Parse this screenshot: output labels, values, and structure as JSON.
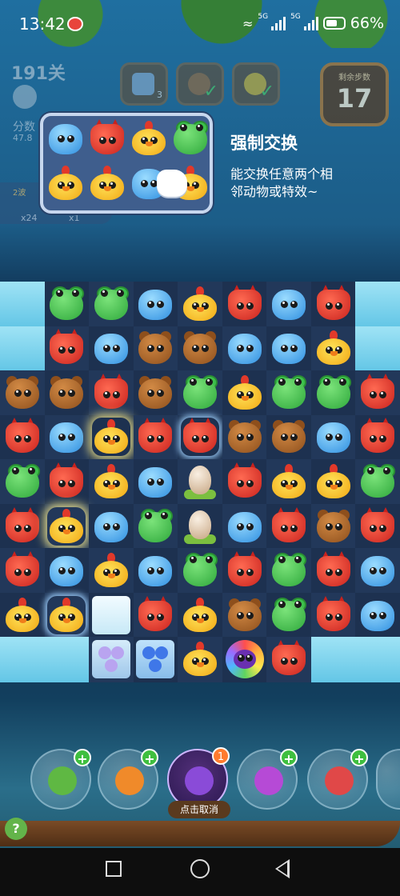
{
  "status_bar": {
    "time": "13:42",
    "network_1": "5G",
    "network_2": "5G",
    "battery": "66%",
    "battery_level": 0.66,
    "icons": [
      "weibo-icon",
      "wifi-icon",
      "signal-icon",
      "battery-icon"
    ]
  },
  "hud": {
    "level": "191关",
    "score_label": "分数",
    "score_value": "47.8",
    "steps_label": "剩余步数",
    "steps_value": "17",
    "goal_1_count": "3",
    "side_badge": "2波",
    "counter_1": "x24",
    "counter_2": "x1"
  },
  "tooltip": {
    "title": "强制交换",
    "line1": "能交换任意两个相",
    "line2": "邻动物或特效~",
    "preview_rows": [
      [
        "blue",
        "fox",
        "chick",
        "frog"
      ],
      [
        "chick",
        "chick",
        "blue",
        "chick"
      ]
    ]
  },
  "board": {
    "rows": [
      [
        "ice",
        "frog",
        "frog",
        "blue",
        "chick",
        "fox",
        "blue",
        "fox",
        "ice"
      ],
      [
        "ice",
        "fox",
        "blue",
        "bear",
        "bear",
        "blue",
        "blue",
        "chick",
        "ice"
      ],
      [
        "bear",
        "bear",
        "fox",
        "bear",
        "frog",
        "chick",
        "frog",
        "frog",
        "fox"
      ],
      [
        "fox",
        "blue",
        "chick*",
        "fox",
        "fox~",
        "bear",
        "bear",
        "blue",
        "fox"
      ],
      [
        "frog",
        "fox",
        "chick",
        "blue",
        "egg",
        "fox",
        "chick",
        "chick",
        "frog"
      ],
      [
        "fox",
        "chick*",
        "blue",
        "frog",
        "egg",
        "blue",
        "fox",
        "bear",
        "fox"
      ],
      [
        "fox",
        "blue",
        "chick",
        "blue",
        "frog",
        "fox",
        "frog",
        "fox",
        "blue"
      ],
      [
        "chick",
        "chick~",
        "iceblock",
        "fox",
        "chick",
        "bear",
        "frog",
        "fox",
        "blue"
      ],
      [
        "ice",
        "ice",
        "purple-ice",
        "blue-ice",
        "chick",
        "owl",
        "fox",
        "ice",
        "ice"
      ]
    ]
  },
  "boosters": [
    {
      "name": "booster-hammer",
      "icon": "hammer-icon",
      "plus": "+"
    },
    {
      "name": "booster-clock",
      "icon": "clock-icon",
      "plus": "+"
    },
    {
      "name": "booster-swap",
      "icon": "swap-icon",
      "count": "1",
      "label": "点击取消"
    },
    {
      "name": "booster-fish",
      "icon": "fish-icon",
      "plus": "+"
    },
    {
      "name": "booster-rocket",
      "icon": "rocket-icon",
      "plus": "+"
    }
  ],
  "help": "?",
  "nav": [
    "back-icon",
    "home-icon",
    "recent-icon"
  ]
}
